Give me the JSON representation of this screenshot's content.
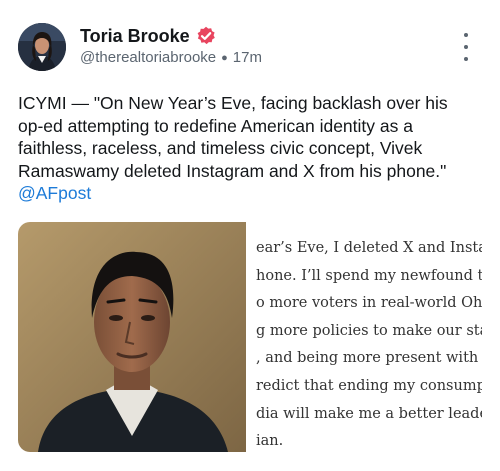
{
  "author": {
    "name": "Toria Brooke",
    "handle": "@therealtoriabrooke",
    "time": "17m",
    "verified_badge_icon": "verified-badge-icon",
    "colors": {
      "badge": "#e8455f"
    }
  },
  "menu_icon": "more-vertical-icon",
  "post": {
    "lines": [
      "ICYMI — \"On New Year’s Eve, facing backlash over his",
      "op-ed attempting to redefine American identity as a",
      "faithless, raceless, and timeless civic concept, Vivek",
      "Ramaswamy deleted Instagram and X from his phone.\""
    ],
    "mention": "@AFpost",
    "colors": {
      "mention": "#1d7bd8"
    }
  },
  "media": {
    "article_lines": [
      "ear’s Eve, I deleted X and Instag",
      "hone. I’ll spend my newfound t",
      "o more voters in real-world Oh",
      "g more policies to make our sta",
      ", and being more present with",
      "redict that ending my consump",
      "dia will make me a better leade",
      "ian."
    ]
  }
}
